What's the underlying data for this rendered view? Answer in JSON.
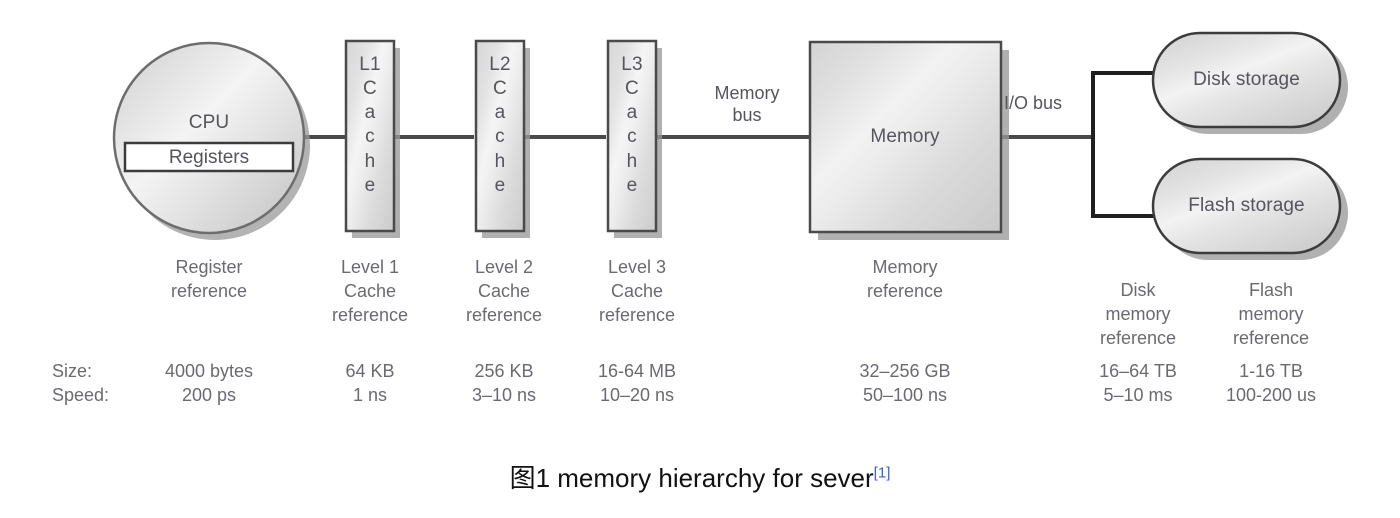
{
  "diagram": {
    "caption_text": "图1 memory hierarchy for sever",
    "caption_citation": "[1]",
    "citation_color": "#3366cc",
    "accent_fill_light": "#f2f2f2",
    "accent_fill_dark": "#cfcfcf",
    "stroke_color": "#4a4a4a",
    "shadow_color": "#9a9a9a",
    "text_color": "#55555d"
  },
  "nodes": {
    "cpu": {
      "label": "CPU",
      "inner_label": "Registers",
      "shape": "circle"
    },
    "l1": {
      "title": "L1",
      "letters": [
        "C",
        "a",
        "c",
        "h",
        "e"
      ],
      "shape": "vertical-box"
    },
    "l2": {
      "title": "L2",
      "letters": [
        "C",
        "a",
        "c",
        "h",
        "e"
      ],
      "shape": "vertical-box"
    },
    "l3": {
      "title": "L3",
      "letters": [
        "C",
        "a",
        "c",
        "h",
        "e"
      ],
      "shape": "vertical-box"
    },
    "memory": {
      "label": "Memory",
      "shape": "square"
    },
    "disk": {
      "label": "Disk storage",
      "shape": "stadium"
    },
    "flash": {
      "label": "Flash storage",
      "shape": "stadium"
    }
  },
  "buses": {
    "memory_bus": "Memory\nbus",
    "io_bus": "I/O bus"
  },
  "references": {
    "register": "Register\nreference",
    "l1": "Level 1\nCache\nreference",
    "l2": "Level 2\nCache\nreference",
    "l3": "Level 3\nCache\nreference",
    "memory": "Memory\nreference",
    "disk": "Disk\nmemory\nreference",
    "flash": "Flash\nmemory\nreference"
  },
  "metrics": {
    "row_labels": {
      "size": "Size:",
      "speed": "Speed:"
    },
    "columns": [
      {
        "key": "registers",
        "size": "4000 bytes",
        "speed": "200 ps"
      },
      {
        "key": "l1",
        "size": "64 KB",
        "speed": "1 ns"
      },
      {
        "key": "l2",
        "size": "256 KB",
        "speed": "3–10 ns"
      },
      {
        "key": "l3",
        "size": "16-64 MB",
        "speed": "10–20 ns"
      },
      {
        "key": "memory",
        "size": "32–256 GB",
        "speed": "50–100 ns"
      },
      {
        "key": "disk",
        "size": "16–64 TB",
        "speed": "5–10 ms"
      },
      {
        "key": "flash",
        "size": "1-16 TB",
        "speed": "100-200 us"
      }
    ]
  }
}
